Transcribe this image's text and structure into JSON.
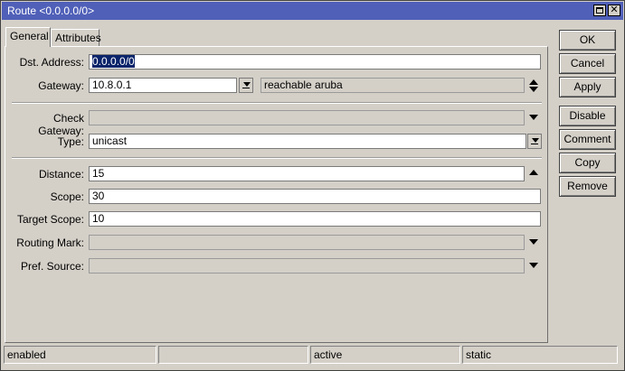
{
  "window": {
    "title": "Route <0.0.0.0/0>"
  },
  "tabs": [
    {
      "label": "General"
    },
    {
      "label": "Attributes"
    }
  ],
  "fields": {
    "dst_address": {
      "label": "Dst. Address:",
      "value": "0.0.0.0/0"
    },
    "gateway": {
      "label": "Gateway:",
      "value": "10.8.0.1",
      "status": "reachable aruba"
    },
    "check_gateway": {
      "label": "Check Gateway:",
      "value": ""
    },
    "type": {
      "label": "Type:",
      "value": "unicast"
    },
    "distance": {
      "label": "Distance:",
      "value": "15"
    },
    "scope": {
      "label": "Scope:",
      "value": "30"
    },
    "target_scope": {
      "label": "Target Scope:",
      "value": "10"
    },
    "routing_mark": {
      "label": "Routing Mark:",
      "value": ""
    },
    "pref_source": {
      "label": "Pref. Source:",
      "value": ""
    }
  },
  "buttons": {
    "ok": "OK",
    "cancel": "Cancel",
    "apply": "Apply",
    "disable": "Disable",
    "comment": "Comment",
    "copy": "Copy",
    "remove": "Remove"
  },
  "status_bar": [
    "enabled",
    "",
    "active",
    "static"
  ]
}
